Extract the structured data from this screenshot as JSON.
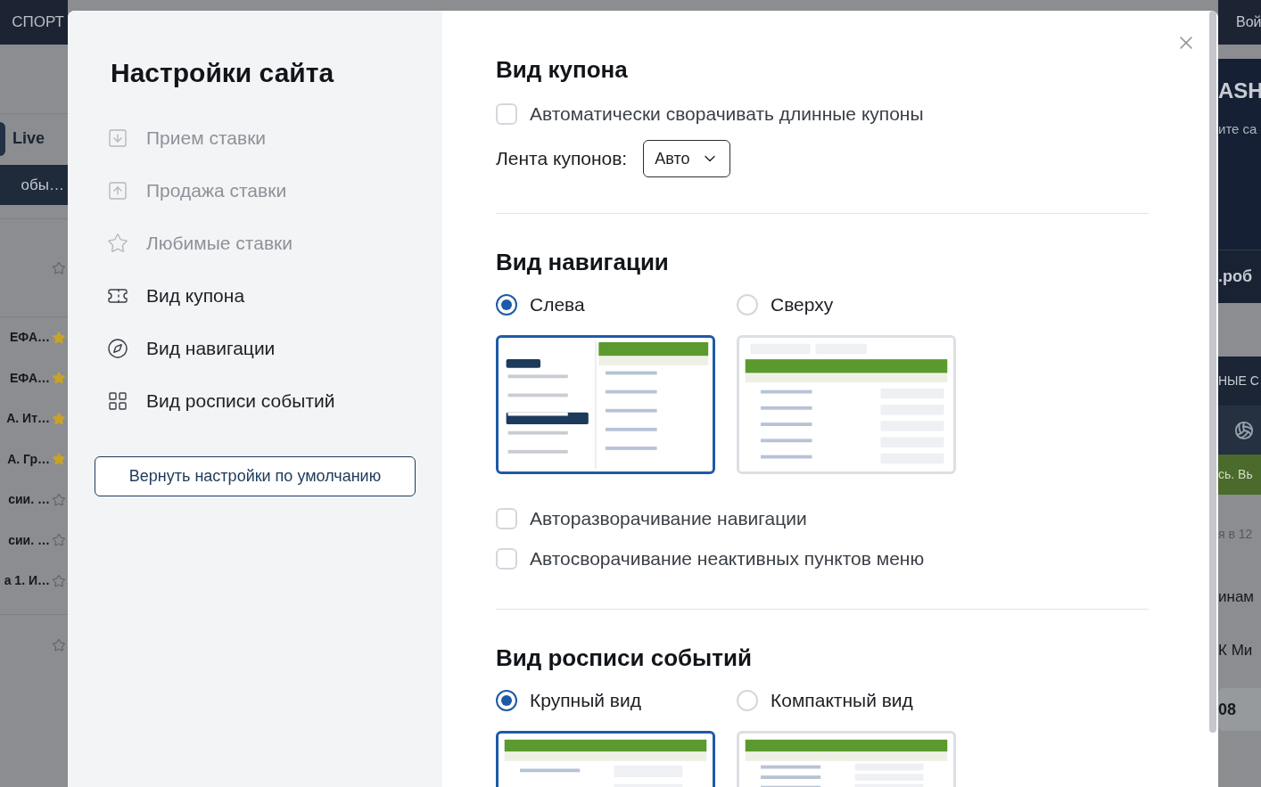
{
  "background": {
    "left": {
      "header": "СПОРТ",
      "tab": "Live",
      "filter": "обы…",
      "rows": [
        {
          "starred": false
        },
        {
          "text": "ЕФА…",
          "starred": true
        },
        {
          "text": "ЕФА…",
          "starred": true
        },
        {
          "text": "А. Ит…",
          "starred": true
        },
        {
          "text": "А. Гр…",
          "starred": true
        },
        {
          "text": "сии. …",
          "starred": false
        },
        {
          "text": "сии. …",
          "starred": false
        },
        {
          "text": "а 1. И…",
          "starred": false
        },
        {
          "starred": false
        }
      ]
    },
    "right": {
      "items": [
        {
          "kind": "header",
          "text": "Вой"
        },
        {
          "kind": "banner",
          "title": "ASH",
          "text": "ите са"
        },
        {
          "kind": "promo",
          "text": ".роб"
        },
        {
          "kind": "gap"
        },
        {
          "kind": "section",
          "text": "НЫЕ С"
        },
        {
          "kind": "icon-bar"
        },
        {
          "kind": "notice",
          "text": "сь. Вь"
        },
        {
          "kind": "meta",
          "text": "я в 12"
        },
        {
          "kind": "team",
          "text": "инам"
        },
        {
          "kind": "team",
          "text": "К Ми"
        },
        {
          "kind": "odd",
          "text": "08"
        }
      ]
    }
  },
  "modal": {
    "title": "Настройки сайта",
    "menu": [
      {
        "label": "Прием ставки",
        "disabled": true
      },
      {
        "label": "Продажа ставки",
        "disabled": true
      },
      {
        "label": "Любимые ставки",
        "disabled": true
      },
      {
        "label": "Вид купона",
        "disabled": false
      },
      {
        "label": "Вид навигации",
        "disabled": false
      },
      {
        "label": "Вид росписи событий",
        "disabled": false
      }
    ],
    "reset_button": "Вернуть настройки по умолчанию",
    "sections": [
      {
        "title": "Вид купона",
        "rows": [
          {
            "kind": "checkbox",
            "label": "Автоматически сворачивать длинные купоны",
            "checked": false
          },
          {
            "kind": "select",
            "label": "Лента купонов:",
            "value": "Авто"
          }
        ]
      },
      {
        "title": "Вид навигации",
        "options": [
          {
            "label": "Слева",
            "selected": true
          },
          {
            "label": "Сверху",
            "selected": false
          }
        ],
        "rows": [
          {
            "kind": "checkbox",
            "label": "Авторазворачивание навигации",
            "checked": false
          },
          {
            "kind": "checkbox",
            "label": "Автосворачивание неактивных пунктов меню",
            "checked": false
          }
        ]
      },
      {
        "title": "Вид росписи событий",
        "options": [
          {
            "label": "Крупный вид",
            "selected": true
          },
          {
            "label": "Компактный вид",
            "selected": false
          }
        ]
      }
    ]
  }
}
